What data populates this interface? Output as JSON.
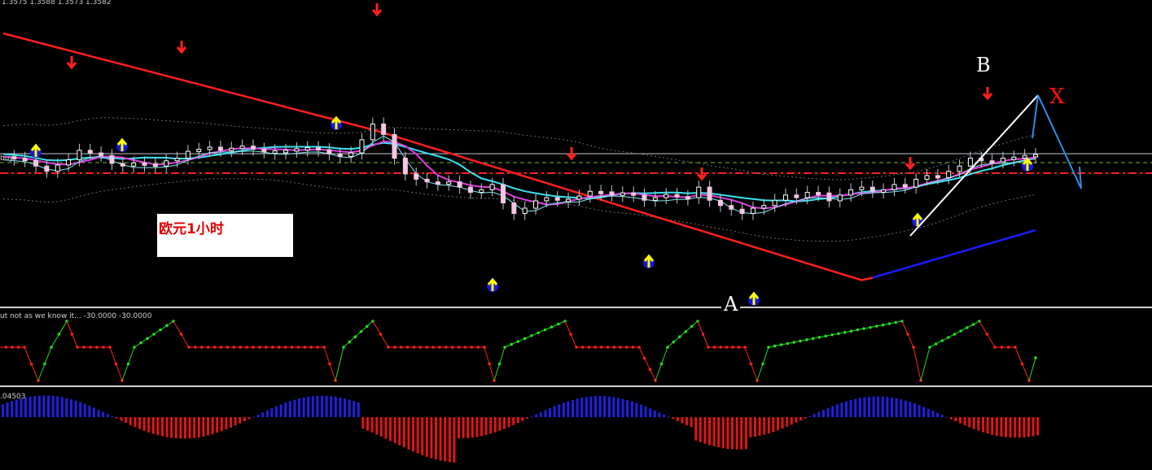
{
  "header": {
    "ohlc_text": "1.3575 1.3588 1.3573 1.3582",
    "buy_label": "buy",
    "ind1_text": "ut not as we know it... -30.0000 -30.0000",
    "ind2_text": ".04503"
  },
  "chart_label": "欧元1小时",
  "points": {
    "a": "A",
    "b": "B",
    "x": "X"
  },
  "colors": {
    "background": "#000000",
    "candle_up": "#ffffff",
    "candle_down": "#f4c6e2",
    "ma_red": "#ff1f1f",
    "ma_blue": "#1b1bff",
    "ma_cyan": "#38e4f2",
    "ma_magenta": "#e03ce0",
    "wpr_red": "#ff2020",
    "wpr_green": "#20e020",
    "hist_pos": "#2020e0",
    "hist_neg": "#e01515",
    "arrow_buy": "#ffff00",
    "arrow_sell": "#ff2020"
  },
  "chart_data": [
    {
      "type": "candlestick",
      "title": "欧元1小时",
      "last_prices": {
        "open": 1.3575,
        "high": 1.3588,
        "low": 1.3573,
        "close": 1.3582
      },
      "series": [
        {
          "name": "price",
          "close": [
            1.3578,
            1.3575,
            1.3571,
            1.356,
            1.355,
            1.3562,
            1.3572,
            1.359,
            1.3585,
            1.358,
            1.3565,
            1.356,
            1.3566,
            1.3564,
            1.356,
            1.357,
            1.3575,
            1.3588,
            1.3592,
            1.3596,
            1.359,
            1.3594,
            1.3598,
            1.3592,
            1.3587,
            1.3589,
            1.359,
            1.3593,
            1.3595,
            1.3591,
            1.3583,
            1.3578,
            1.3585,
            1.361,
            1.364,
            1.362,
            1.3575,
            1.3545,
            1.3535,
            1.353,
            1.3528,
            1.353,
            1.352,
            1.351,
            1.3515,
            1.3525,
            1.349,
            1.347,
            1.348,
            1.3494,
            1.35,
            1.3495,
            1.3497,
            1.3503,
            1.3512,
            1.3511,
            1.3505,
            1.3509,
            1.3505,
            1.3495,
            1.35,
            1.3506,
            1.3502,
            1.35,
            1.352,
            1.3495,
            1.3485,
            1.3478,
            1.347,
            1.348,
            1.3485,
            1.3495,
            1.3505,
            1.35,
            1.351,
            1.3509,
            1.3494,
            1.3505,
            1.3515,
            1.352,
            1.3512,
            1.3515,
            1.3525,
            1.352,
            1.3535,
            1.3542,
            1.3538,
            1.355,
            1.356,
            1.3575,
            1.357,
            1.3568,
            1.3575,
            1.3577,
            1.358,
            1.3582
          ]
        }
      ],
      "annotations": [
        "A",
        "B",
        "X"
      ]
    },
    {
      "type": "line",
      "title": "ut not as we know it...",
      "values_shown": [
        -30.0,
        -30.0
      ]
    },
    {
      "type": "bar",
      "title": ".04503"
    }
  ]
}
